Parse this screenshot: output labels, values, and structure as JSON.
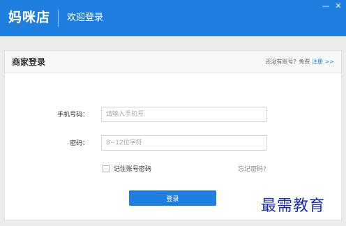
{
  "app": {
    "brand": "妈咪店",
    "welcome": "欢迎登录"
  },
  "window_controls": {
    "minimize_icon": "minus-icon",
    "close_icon": "close-icon"
  },
  "card": {
    "title": "商家登录",
    "register_prompt": "还没有账号？免费",
    "register_link": "注册 >>"
  },
  "form": {
    "phone_label": "手机号码：",
    "phone_placeholder": "请输入手机号",
    "phone_value": "",
    "password_label": "密码：",
    "password_placeholder": "8~12位字符",
    "password_value": "",
    "remember_label": "记住账号密码",
    "remember_checked": false,
    "forgot_label": "忘记密码?",
    "login_label": "登录"
  },
  "watermark": "最需教育",
  "colors": {
    "brand_blue": "#1f7fe0",
    "watermark": "#1b2bb8"
  }
}
